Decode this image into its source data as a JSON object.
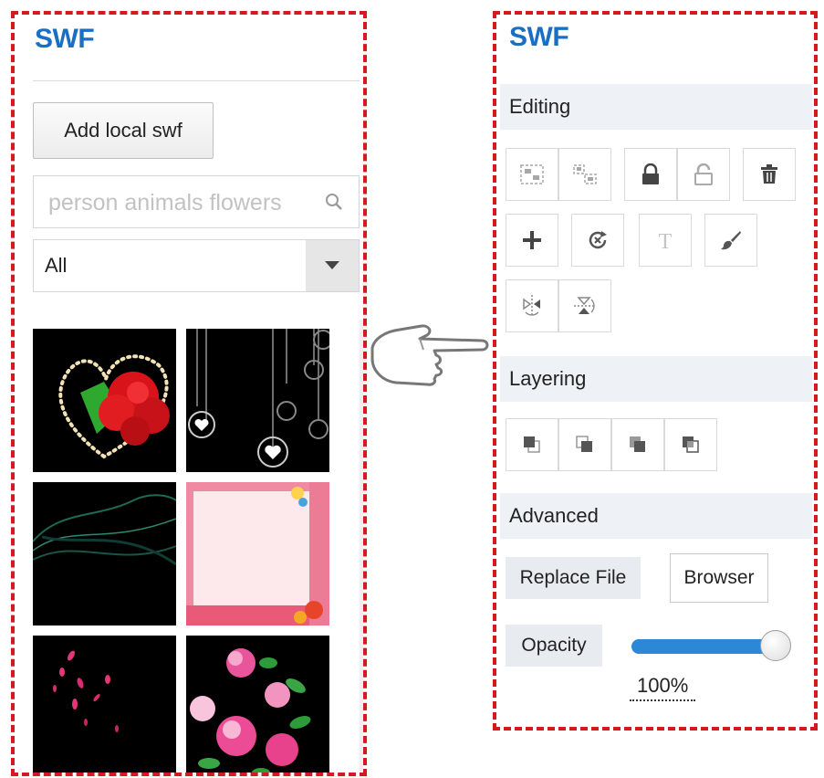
{
  "left_panel": {
    "title": "SWF",
    "add_button_label": "Add local swf",
    "search": {
      "placeholder": "person animals flowers",
      "value": ""
    },
    "category_select": {
      "selected": "All"
    },
    "thumbnails": [
      {
        "name": "heart-roses"
      },
      {
        "name": "hanging-hearts"
      },
      {
        "name": "green-light-waves"
      },
      {
        "name": "pink-floral-frame"
      },
      {
        "name": "falling-petals"
      },
      {
        "name": "peony-flowers"
      }
    ]
  },
  "pointer": {
    "icon": "pointing-hand-icon"
  },
  "right_panel": {
    "title": "SWF",
    "sections": {
      "editing": "Editing",
      "layering": "Layering",
      "advanced": "Advanced"
    },
    "editing_tools": [
      "group-icon",
      "ungroup-icon",
      "lock-icon",
      "unlock-icon",
      "delete-icon",
      "add-icon",
      "reset-icon",
      "text-icon",
      "brush-icon",
      "flip-horizontal-icon",
      "flip-vertical-icon"
    ],
    "layering_tools": [
      "bring-to-front-icon",
      "send-to-back-icon",
      "bring-forward-icon",
      "send-backward-icon"
    ],
    "replace_file_label": "Replace File",
    "browser_label": "Browser",
    "opacity_label": "Opacity",
    "opacity_value": "100%",
    "opacity_fraction": 1.0
  },
  "colors": {
    "accent_title": "#1a6fc4",
    "dashed_border": "#d4191f",
    "slider_fill": "#2d87d7",
    "section_bg": "#eef1f5"
  }
}
